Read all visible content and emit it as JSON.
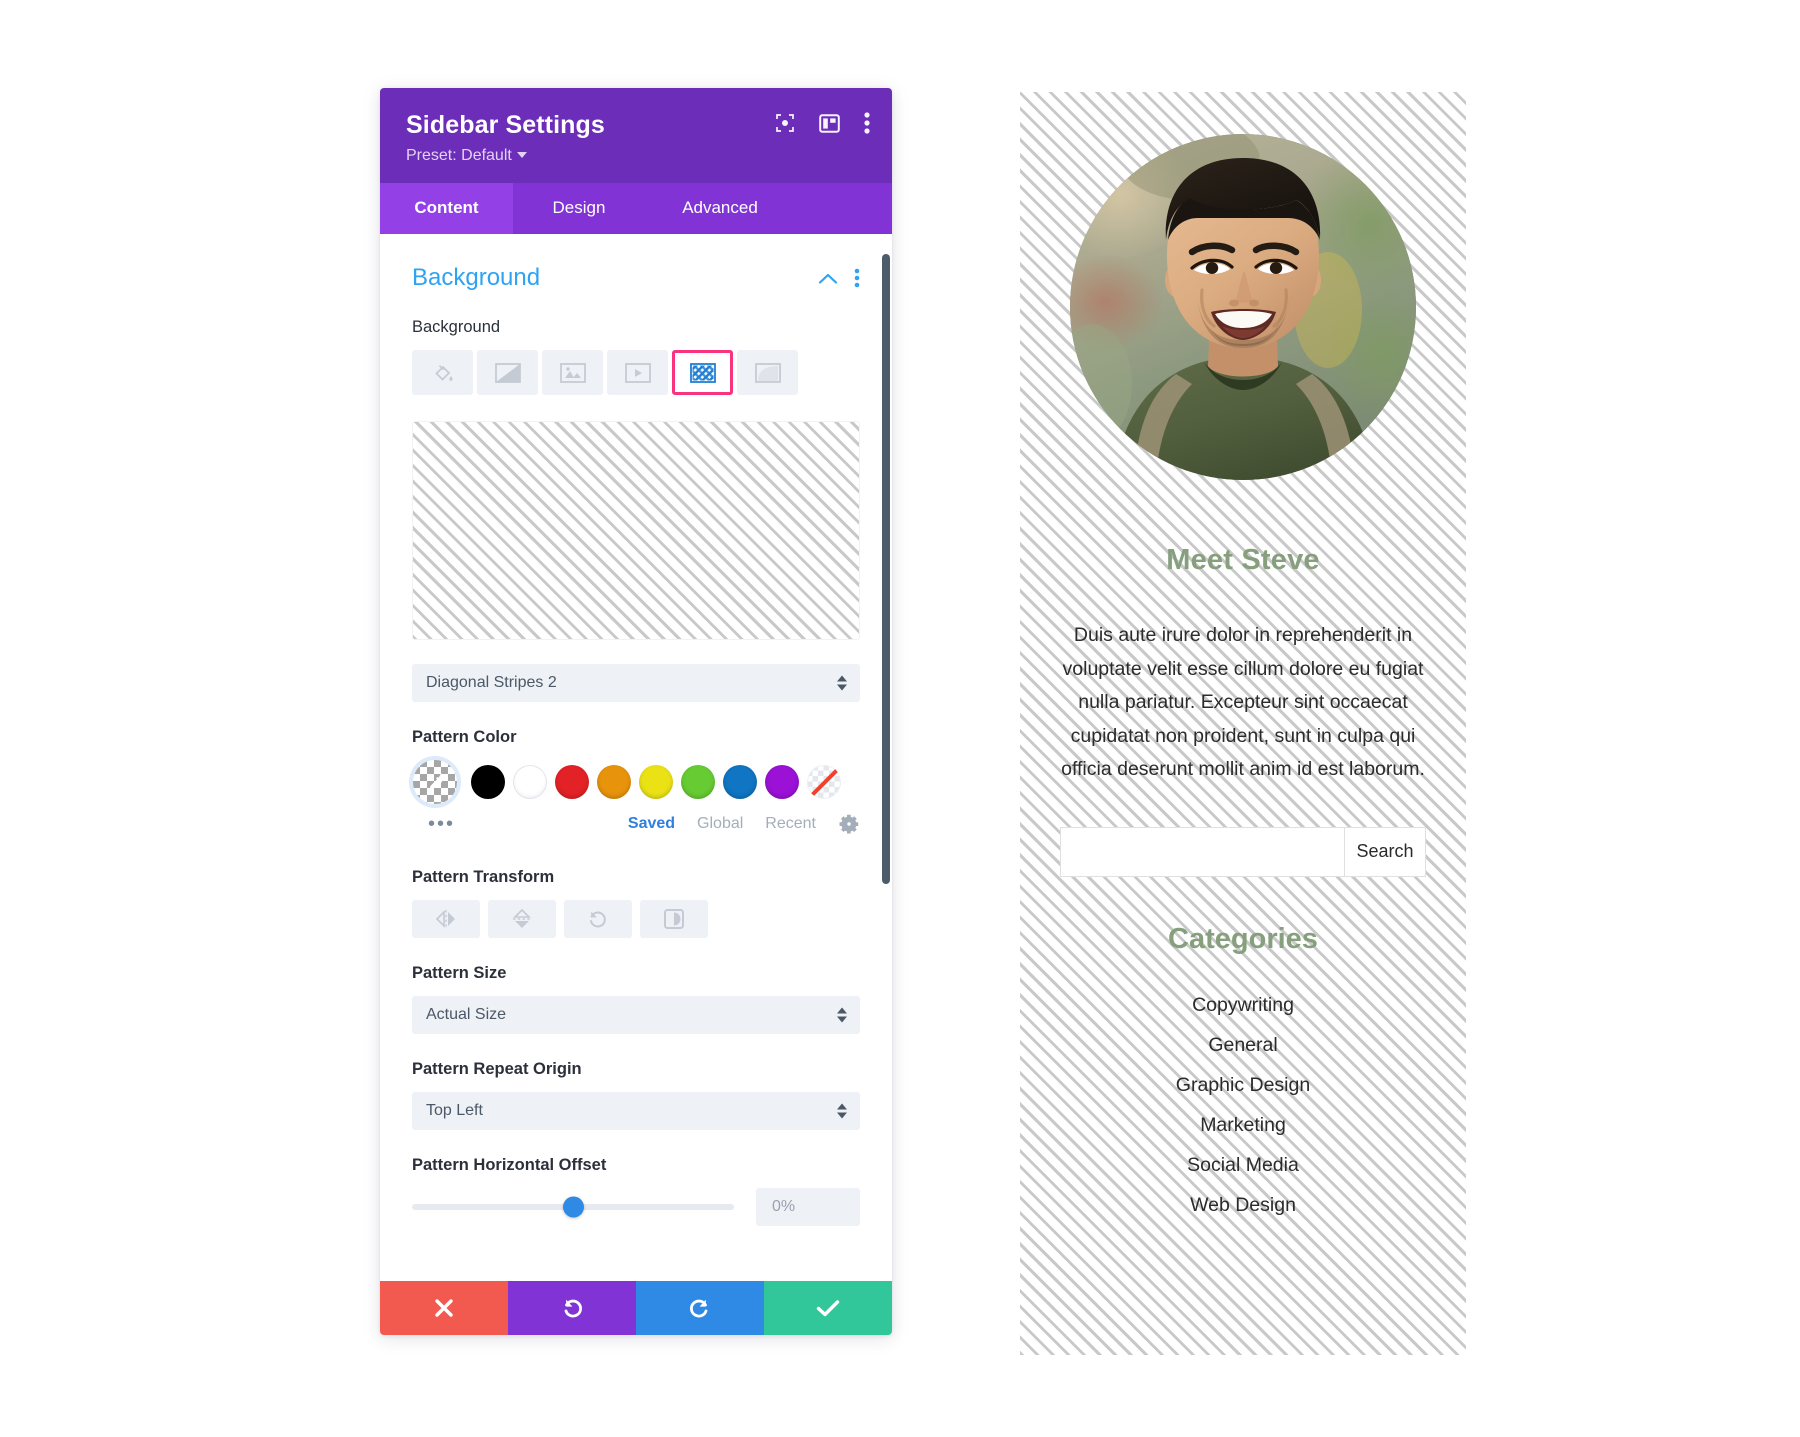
{
  "settings": {
    "title": "Sidebar Settings",
    "preset_label": "Preset: Default",
    "header_icons": [
      {
        "name": "focus-icon"
      },
      {
        "name": "layout-columns-icon"
      },
      {
        "name": "more-vertical-icon"
      }
    ],
    "tabs": [
      {
        "label": "Content",
        "active": true
      },
      {
        "label": "Design",
        "active": false
      },
      {
        "label": "Advanced",
        "active": false
      }
    ],
    "section": {
      "title": "Background",
      "collapse_icon": "chevron-up-icon",
      "menu_icon": "more-vertical-icon"
    },
    "background": {
      "label": "Background",
      "types": [
        {
          "name": "background-color-icon",
          "selected": false
        },
        {
          "name": "background-gradient-icon",
          "selected": false
        },
        {
          "name": "background-image-icon",
          "selected": false
        },
        {
          "name": "background-video-icon",
          "selected": false
        },
        {
          "name": "background-pattern-icon",
          "selected": true
        },
        {
          "name": "background-mask-icon",
          "selected": false
        }
      ],
      "selected_highlight_color": "#f9337e"
    },
    "pattern_select": {
      "value": "Diagonal Stripes 2"
    },
    "pattern_color": {
      "label": "Pattern Color",
      "swatches": [
        {
          "name": "eyedropper-swatch",
          "color": "transparent",
          "selected": true
        },
        {
          "name": "swatch-black",
          "color": "#000000"
        },
        {
          "name": "swatch-white",
          "color": "#ffffff"
        },
        {
          "name": "swatch-red",
          "color": "#e32227"
        },
        {
          "name": "swatch-orange",
          "color": "#e8930c"
        },
        {
          "name": "swatch-yellow",
          "color": "#eae215"
        },
        {
          "name": "swatch-green",
          "color": "#67cb33"
        },
        {
          "name": "swatch-blue",
          "color": "#1075c2"
        },
        {
          "name": "swatch-purple",
          "color": "#9b11d6"
        },
        {
          "name": "swatch-none",
          "color": "none"
        }
      ],
      "more_dots": "•••",
      "tabs": [
        {
          "label": "Saved",
          "active": true
        },
        {
          "label": "Global",
          "active": false
        },
        {
          "label": "Recent",
          "active": false
        }
      ],
      "settings_icon": "gear-icon"
    },
    "pattern_transform": {
      "label": "Pattern Transform",
      "buttons": [
        {
          "name": "flip-horizontal-icon"
        },
        {
          "name": "flip-vertical-icon"
        },
        {
          "name": "rotate-icon"
        },
        {
          "name": "invert-icon"
        }
      ]
    },
    "pattern_size": {
      "label": "Pattern Size",
      "value": "Actual Size"
    },
    "pattern_repeat_origin": {
      "label": "Pattern Repeat Origin",
      "value": "Top Left"
    },
    "pattern_horizontal_offset": {
      "label": "Pattern Horizontal Offset",
      "value": "0%",
      "slider_percent": 50
    },
    "actions": [
      {
        "name": "cancel-button",
        "icon": "close-icon",
        "color": "#f25a4f"
      },
      {
        "name": "undo-button",
        "icon": "undo-icon",
        "color": "#8133d6"
      },
      {
        "name": "redo-button",
        "icon": "redo-icon",
        "color": "#2e8ae5"
      },
      {
        "name": "save-button",
        "icon": "check-icon",
        "color": "#32c79a"
      }
    ]
  },
  "preview": {
    "avatar_alt": "portrait of smiling man in olive green t-shirt",
    "heading": "Meet Steve",
    "body": "Duis aute irure dolor in reprehenderit in voluptate velit esse cillum dolore eu fugiat nulla pariatur. Excepteur sint occaecat cupidatat non proident, sunt in culpa qui officia deserunt mollit anim id est laborum.",
    "search": {
      "value": "",
      "placeholder": "",
      "button_label": "Search"
    },
    "categories_title": "Categories",
    "categories": [
      "Copywriting",
      "General",
      "Graphic Design",
      "Marketing",
      "Social Media",
      "Web Design"
    ],
    "heading_color": "#86a07e"
  }
}
